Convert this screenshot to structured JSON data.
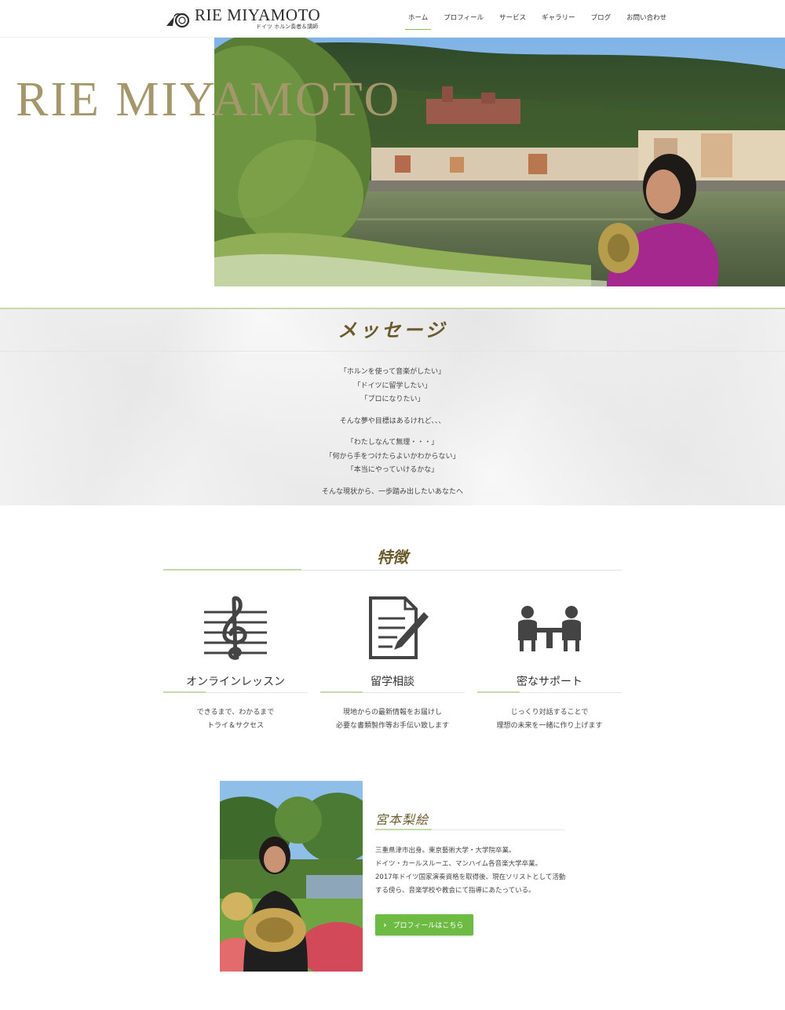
{
  "site": {
    "logo_name": "RIE MIYAMOTO",
    "logo_sub": "ドイツ ホルン奏者＆講師"
  },
  "nav": {
    "items": [
      {
        "label": "ホーム",
        "active": true
      },
      {
        "label": "プロフィール"
      },
      {
        "label": "サービス"
      },
      {
        "label": "ギャラリー"
      },
      {
        "label": "ブログ"
      },
      {
        "label": "お問い合わせ"
      }
    ]
  },
  "hero": {
    "title": "RIE MIYAMOTO"
  },
  "message": {
    "title": "メッセージ",
    "lines": [
      "「ホルンを使って音楽がしたい」",
      "「ドイツに留学したい」",
      "「プロになりたい」",
      "そんな夢や目標はあるけれど、、、",
      "「わたしなんて無理・・・」",
      "「何から手をつけたらよいかわからない」",
      "「本当にやっていけるかな」",
      "そんな現状から、一歩踏み出したいあなたへ"
    ]
  },
  "features": {
    "title": "特徴",
    "items": [
      {
        "icon": "treble-clef-icon",
        "name": "オンラインレッスン",
        "desc1": "できるまで、わかるまで",
        "desc2": "トライ＆サクセス"
      },
      {
        "icon": "document-pen-icon",
        "name": "留学相談",
        "desc1": "現地からの最新情報をお届けし",
        "desc2": "必要な書類製作等お手伝い致します"
      },
      {
        "icon": "meeting-icon",
        "name": "密なサポート",
        "desc1": "じっくり対話することで",
        "desc2": "理想の未来を一緒に作り上げます"
      }
    ]
  },
  "profile": {
    "name": "宮本梨絵",
    "lines": [
      "三重県津市出身。東京藝術大学・大学院卒業。",
      "ドイツ・カールスルーエ、マンハイム各音楽大学卒業。",
      "2017年ドイツ国家演奏資格を取得後、現在ソリストとして活動",
      "する傍ら、音楽学校や教会にて指導にあたっている。"
    ],
    "button_label": "プロフィールはこちら"
  },
  "colors": {
    "accent_green": "#6dbb42",
    "gold": "#a5976c",
    "heading_brown": "#6b5a2b"
  }
}
